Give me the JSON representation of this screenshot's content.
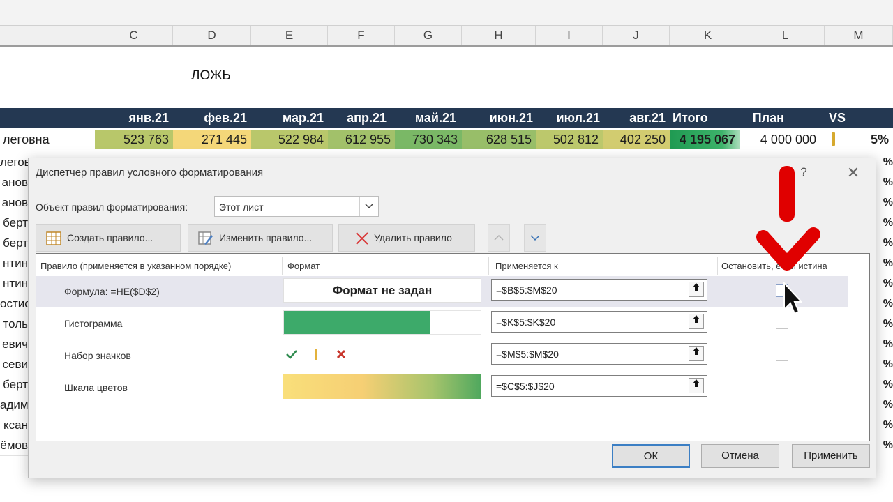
{
  "columns": [
    "C",
    "D",
    "E",
    "F",
    "G",
    "H",
    "I",
    "J",
    "K",
    "L",
    "M"
  ],
  "sheet_cell_text": "ЛОЖЬ",
  "table_header": [
    "янв.21",
    "фев.21",
    "мар.21",
    "апр.21",
    "май.21",
    "июн.21",
    "июл.21",
    "авг.21",
    "Итого",
    "План",
    "VS"
  ],
  "first_row": {
    "name": "легoвна",
    "values": [
      "523 763",
      "271 445",
      "522 984",
      "612 955",
      "730 343",
      "628 515",
      "502 812",
      "402 250"
    ],
    "total": "4 195 067",
    "plan": "4 000 000",
    "vs": "5%"
  },
  "row_names": [
    "легов",
    "анов",
    "анов",
    "берт",
    "берт",
    "нтин",
    "нтин",
    "остис",
    "толь",
    "евич",
    "севи",
    "берт",
    "адим",
    "ксан",
    "ёмов"
  ],
  "row_pct": [
    "%",
    "%",
    "%",
    "%",
    "%",
    "%",
    "%",
    "%",
    "%",
    "%",
    "%",
    "%",
    "%",
    "%",
    "%"
  ],
  "dialog": {
    "title": "Диспетчер правил условного форматирования",
    "help": "?",
    "close": "✕",
    "scope_label": "Объект правил форматирования:",
    "scope_value": "Этот лист",
    "buttons": {
      "new_rule": "Создать правило...",
      "edit_rule": "Изменить правило...",
      "delete_rule": "Удалить правило",
      "move_up": "▲",
      "move_down": "▼"
    },
    "table_headers": {
      "rule": "Правило (применяется в указанном порядке)",
      "format": "Формат",
      "applies_to": "Применяется к",
      "stop_if_true": "Остановить, если истина"
    },
    "rules": [
      {
        "name": "Формула: =НЕ($D$2)",
        "format_text": "Формат не задан",
        "applies_to": "=$B$5:$M$20",
        "selected": true
      },
      {
        "name": "Гистограмма",
        "applies_to": "=$K$5:$K$20",
        "bar_fill": 0.74
      },
      {
        "name": "Набор значков",
        "applies_to": "=$M$5:$M$20"
      },
      {
        "name": "Шкала цветов",
        "applies_to": "=$C$5:$J$20"
      }
    ],
    "ok": "ОК",
    "cancel": "Отмена",
    "apply": "Применить"
  },
  "colors": {
    "header_bg": "#243852",
    "databar": "#3daa6a",
    "scale_low": "#f9df7a",
    "scale_high": "#4fa85e",
    "annotation": "#e00000",
    "selection": "#e6e6ee"
  }
}
